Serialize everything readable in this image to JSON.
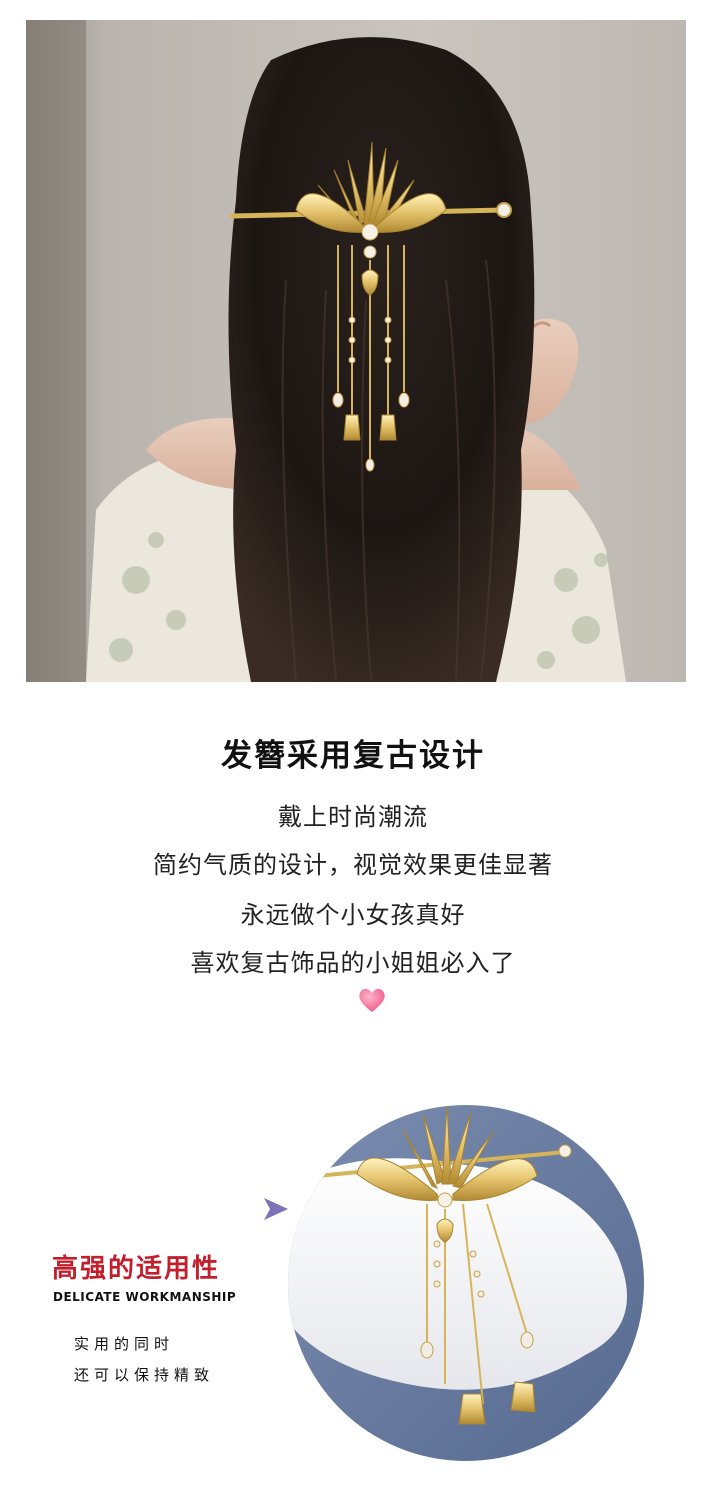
{
  "headline": "发簪采用复古设计",
  "copy_lines": [
    "戴上时尚潮流",
    "简约气质的设计，视觉效果更佳显著",
    "永远做个小女孩真好",
    "喜欢复古饰品的小姐姐必入了"
  ],
  "feature": {
    "title": "高强的适用性",
    "subtitle": "DELICATE WORKMANSHIP",
    "lines": [
      "实用的同时",
      "还可以保持精致"
    ]
  },
  "icons": {
    "heart": "heart-icon",
    "arrow": "triangle-arrow-icon"
  },
  "colors": {
    "accent_red": "#c21f2d",
    "heart_pink": "#ef5a8a",
    "arrow_purple": "#7d72b8",
    "gold": "#d9b45a"
  }
}
